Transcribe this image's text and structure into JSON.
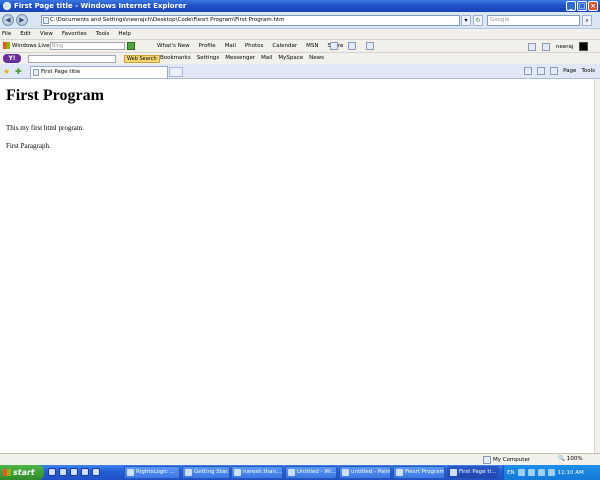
{
  "window": {
    "title": "First Page title - Windows Internet Explorer"
  },
  "address_bar": {
    "url": "C:\\Documents and Settings\\neerajch\\Desktop\\Code\\Fiesrt Program\\First Program.htm",
    "search_placeholder": "Google"
  },
  "menu": [
    "File",
    "Edit",
    "View",
    "Favorites",
    "Tools",
    "Help"
  ],
  "live_toolbar": {
    "logo_label": "Windows Live",
    "search_placeholder": "Bing",
    "links": [
      "What's New",
      "Profile",
      "Mail",
      "Photos",
      "Calendar",
      "MSN",
      "Share"
    ],
    "user": "neeraj"
  },
  "yahoo_toolbar": {
    "logo": "Y!",
    "web_search": "Web Search",
    "items": [
      "Bookmarks",
      "Settings",
      "Messenger",
      "Mail",
      "MySpace",
      "News"
    ]
  },
  "tabs": [
    {
      "label": "First Page title"
    }
  ],
  "command_bar": {
    "page": "Page",
    "tools": "Tools"
  },
  "content": {
    "heading": "First Program",
    "paragraphs": [
      "This my first html program.",
      "First Paragraph."
    ]
  },
  "status_bar": {
    "zone": "My Computer",
    "zoom": "100%"
  },
  "taskbar": {
    "start": "start",
    "tasks": [
      "RightsLogic ...",
      "Getting Star...",
      "naresh.than...",
      "Untitled - Wi...",
      "untitled - Paint",
      "Fiesrt Program",
      "First Page ti..."
    ],
    "lang": "EN",
    "clock": "11:10 AM"
  }
}
